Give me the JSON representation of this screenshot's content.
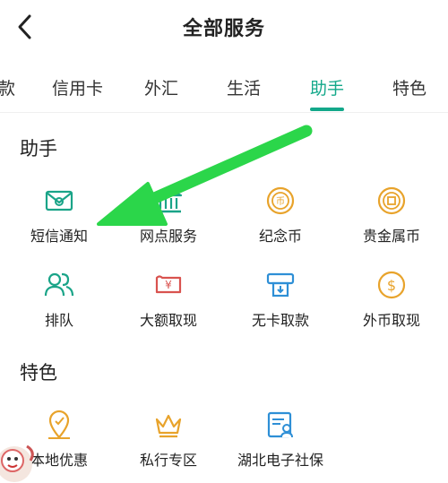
{
  "header": {
    "title": "全部服务",
    "back_icon": "chevron-left-icon"
  },
  "tabs": [
    {
      "label": "款",
      "active": false
    },
    {
      "label": "信用卡",
      "active": false
    },
    {
      "label": "外汇",
      "active": false
    },
    {
      "label": "生活",
      "active": false
    },
    {
      "label": "助手",
      "active": true
    },
    {
      "label": "特色",
      "active": false
    }
  ],
  "sections": [
    {
      "title": "助手",
      "items": [
        {
          "label": "短信通知",
          "icon": "sms-envelope-icon",
          "color": "#1aa488"
        },
        {
          "label": "网点服务",
          "icon": "bank-building-icon",
          "color": "#1aa488"
        },
        {
          "label": "纪念币",
          "icon": "commemorative-coin-icon",
          "color": "#e8a32b"
        },
        {
          "label": "贵金属币",
          "icon": "precious-metal-coin-icon",
          "color": "#e8a32b"
        },
        {
          "label": "排队",
          "icon": "queue-people-icon",
          "color": "#1aa488"
        },
        {
          "label": "大额取现",
          "icon": "yuan-banknote-icon",
          "color": "#d9534f"
        },
        {
          "label": "无卡取款",
          "icon": "atm-withdraw-icon",
          "color": "#2e8fd6"
        },
        {
          "label": "外币取现",
          "icon": "dollar-coin-icon",
          "color": "#e8a32b"
        }
      ]
    },
    {
      "title": "特色",
      "items": [
        {
          "label": "本地优惠",
          "icon": "location-discount-icon",
          "color": "#e8a32b"
        },
        {
          "label": "私行专区",
          "icon": "crown-icon",
          "color": "#e8a32b"
        },
        {
          "label": "湖北电子社保",
          "icon": "social-security-card-icon",
          "color": "#2e8fd6"
        }
      ]
    }
  ],
  "annotation_arrow_color": "#2bd64a"
}
